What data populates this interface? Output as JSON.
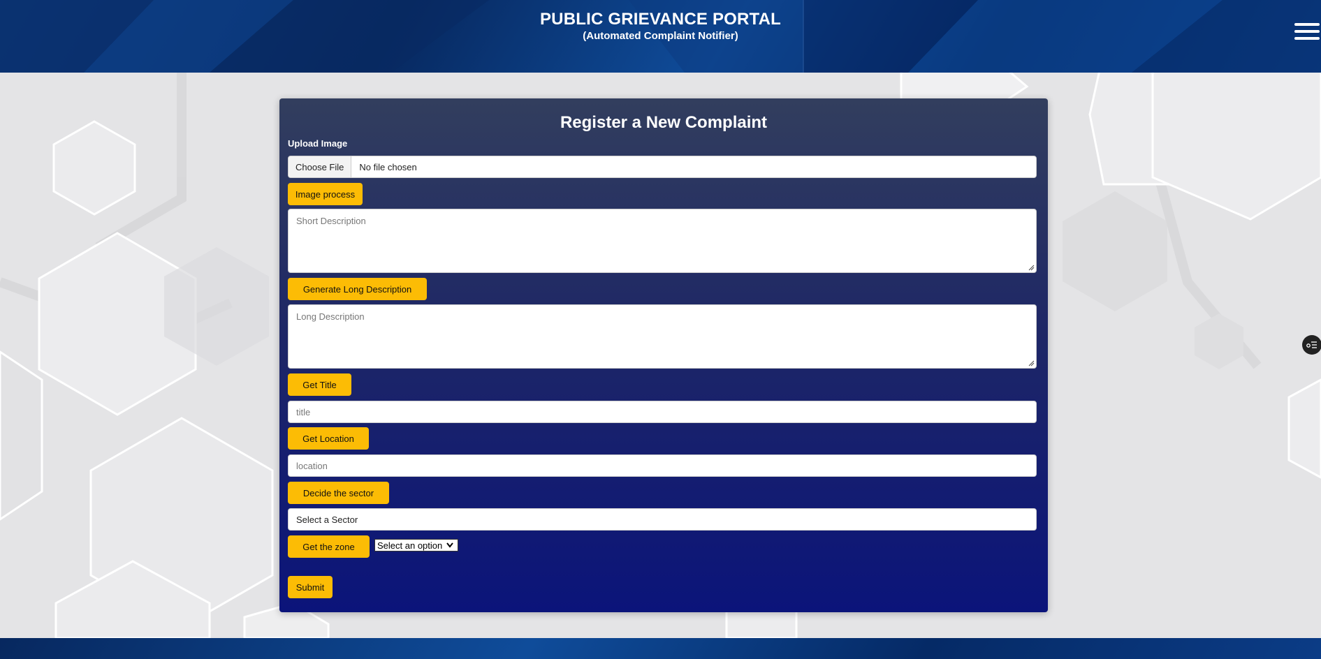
{
  "header": {
    "title": "PUBLIC GRIEVANCE PORTAL",
    "subtitle": "(Automated Complaint Notifier)",
    "menu_icon": "hamburger-menu-icon"
  },
  "form": {
    "title": "Register a New Complaint",
    "upload_label": "Upload Image",
    "file_button": "Choose File",
    "file_status": "No file chosen",
    "image_process_button": "Image process",
    "short_description_placeholder": "Short Description",
    "generate_long_button": "Generate Long Description",
    "long_description_placeholder": "Long Description",
    "get_title_button": "Get Title",
    "title_placeholder": "title",
    "get_location_button": "Get Location",
    "location_placeholder": "location",
    "decide_sector_button": "Decide the sector",
    "sector_select_value": "Select a Sector",
    "get_zone_button": "Get the zone",
    "zone_select_value": "Select an option",
    "submit_button": "Submit"
  },
  "colors": {
    "accent_button": "#fcbc05",
    "header_blue": "#0b3c86",
    "panel_bottom": "#0b147a"
  },
  "side_widget_icon": "settings-list-icon"
}
